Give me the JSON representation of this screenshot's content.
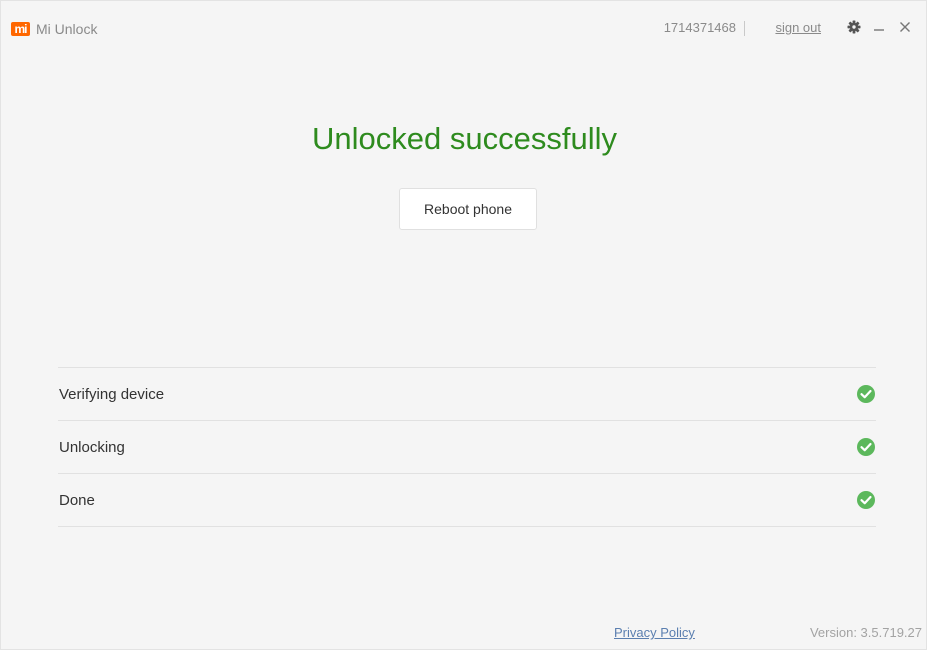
{
  "titlebar": {
    "logo_text": "mi",
    "app_title": "Mi Unlock",
    "account_id": "1714371468",
    "sign_out_label": "sign out",
    "icons": [
      "gear-icon",
      "minimize-icon",
      "close-icon"
    ]
  },
  "main": {
    "headline": "Unlocked successfully",
    "reboot_button_label": "Reboot phone"
  },
  "steps": [
    {
      "label": "Verifying device",
      "status": "done",
      "icon": "check-circle-icon"
    },
    {
      "label": "Unlocking",
      "status": "done",
      "icon": "check-circle-icon"
    },
    {
      "label": "Done",
      "status": "done",
      "icon": "check-circle-icon"
    }
  ],
  "footer": {
    "privacy_label": "Privacy Policy",
    "version_text": "Version: 3.5.719.27"
  },
  "colors": {
    "brand": "#ff6700",
    "success_text": "#2e8b1e",
    "check_green": "#5cb85c",
    "link": "#5b7fb0"
  }
}
